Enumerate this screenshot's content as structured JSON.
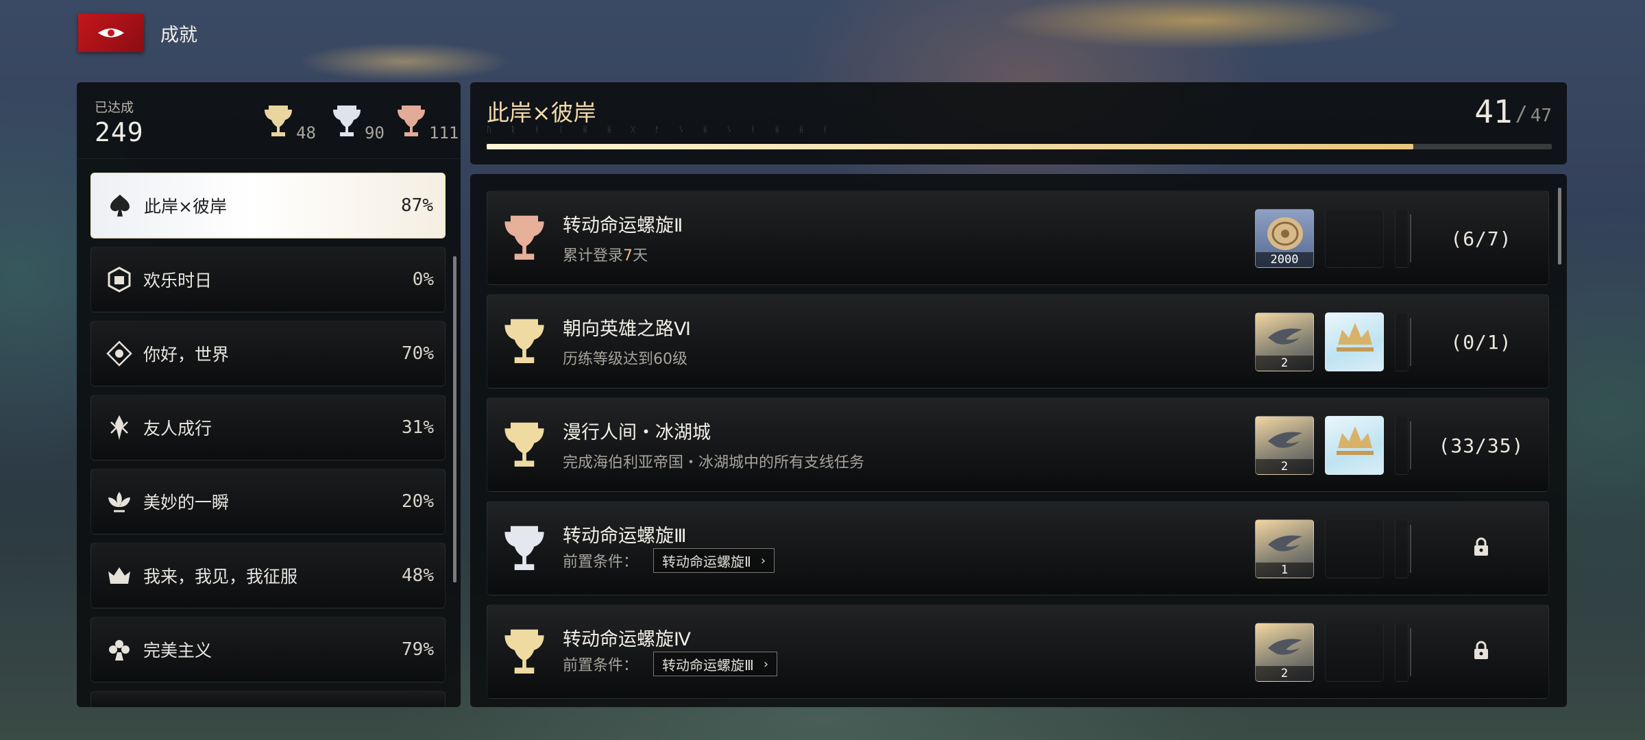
{
  "header": {
    "title": "成就",
    "icon": "red-flag-emblem-icon"
  },
  "summary": {
    "label": "已达成",
    "total": "249",
    "trophies": [
      {
        "tier": "gold",
        "count": "48",
        "color": "#e9d5a0"
      },
      {
        "tier": "silver",
        "count": "90",
        "color": "#dfe3ea"
      },
      {
        "tier": "bronze",
        "count": "111",
        "color": "#e2ab98"
      }
    ]
  },
  "categories": [
    {
      "name": "此岸×彼岸",
      "pct": "87%",
      "icon": "spade-emblem-icon",
      "active": true
    },
    {
      "name": "欢乐时日",
      "pct": "0%",
      "icon": "cube-emblem-icon",
      "active": false
    },
    {
      "name": "你好，世界",
      "pct": "70%",
      "icon": "diamond-eye-emblem-icon",
      "active": false
    },
    {
      "name": "友人成行",
      "pct": "31%",
      "icon": "blade-emblem-icon",
      "active": false
    },
    {
      "name": "美妙的一瞬",
      "pct": "20%",
      "icon": "lotus-emblem-icon",
      "active": false
    },
    {
      "name": "我来，我见，我征服",
      "pct": "48%",
      "icon": "crown-emblem-icon",
      "active": false
    },
    {
      "name": "完美主义",
      "pct": "79%",
      "icon": "flower-emblem-icon",
      "active": false
    }
  ],
  "section": {
    "title": "此岸×彼岸",
    "decor_text": "ᚢ ᚱ ᚾ ᛁ ᚺ ᚺ ᚷ ᚨ ᛊ ᚺ ᛊ ᚾ ᚺ ᚺ ᚾ",
    "done": "41",
    "total": "47",
    "progress_fraction": 0.87
  },
  "achievements": [
    {
      "name": "转动命运螺旋Ⅱ",
      "desc_pre": "累计登录",
      "desc_hl": "7",
      "desc_post": "天",
      "tier": "bronze",
      "rewards": [
        {
          "type": "coin",
          "qty": "2000"
        },
        {
          "type": "empty"
        }
      ],
      "progress": "(6/7)",
      "locked": false
    },
    {
      "name": "朝向英雄之路Ⅵ",
      "desc_pre": "历练等级达到60级",
      "tier": "gold",
      "rewards": [
        {
          "type": "feather",
          "qty": "2"
        },
        {
          "type": "crown"
        }
      ],
      "progress": "(0/1)",
      "locked": false
    },
    {
      "name": "漫行人间・冰湖城",
      "desc_pre": "完成海伯利亚帝国・冰湖城中的所有支线任务",
      "tier": "gold",
      "rewards": [
        {
          "type": "feather",
          "qty": "2"
        },
        {
          "type": "crown"
        }
      ],
      "progress": "(33/35)",
      "locked": false
    },
    {
      "name": "转动命运螺旋Ⅲ",
      "prereq_label": "前置条件：",
      "prereq_target": "转动命运螺旋Ⅱ",
      "tier": "silver",
      "rewards": [
        {
          "type": "feather",
          "qty": "1"
        },
        {
          "type": "empty"
        }
      ],
      "locked": true
    },
    {
      "name": "转动命运螺旋Ⅳ",
      "prereq_label": "前置条件：",
      "prereq_target": "转动命运螺旋Ⅲ",
      "tier": "gold",
      "rewards": [
        {
          "type": "feather",
          "qty": "2"
        },
        {
          "type": "empty"
        }
      ],
      "locked": true
    }
  ]
}
